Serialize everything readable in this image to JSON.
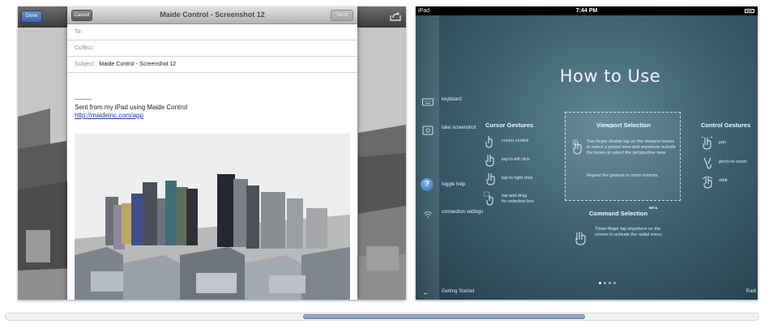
{
  "left_screenshot": {
    "toolbar": {
      "done_label": "Done"
    },
    "email": {
      "cancel_label": "Cancel",
      "title": "Maide Control - Screenshot 12",
      "send_label": "Send",
      "to_label": "To:",
      "ccbcc_label": "Cc/Bcc:",
      "subject_label": "Subject:",
      "subject_value": "Maide Control - Screenshot 12",
      "signature_dashes": "--------",
      "signature_text": "Sent from my iPad using Maide Control",
      "link": "http://maideinc.com/app"
    }
  },
  "right_screenshot": {
    "status_bar": {
      "carrier": "iPad",
      "time": "7:44 PM"
    },
    "sidebar": [
      {
        "label": "keyboard",
        "icon": "keyboard-icon"
      },
      {
        "label": "take screenshot",
        "icon": "screenshot-icon"
      },
      {
        "label": "toggle help",
        "icon": "help-icon"
      },
      {
        "label": "connection settings",
        "icon": "wifi-icon"
      }
    ],
    "title": "How to Use",
    "cursor_gestures": {
      "heading": "Cursor Gestures",
      "items": [
        "cursor control",
        "tap to left click",
        "tap to right click",
        "tap and drag",
        "for selection box"
      ]
    },
    "viewport_selection": {
      "heading": "Viewport Selection",
      "text1": "Two-finger double tap on the viewport boxes to select a preset view and anywhere outside the boxes to select the perspective view.",
      "text2": "Repeat the gesture to zoom extents."
    },
    "command_selection": {
      "heading": "Command Selection",
      "badge": "BETA",
      "text": "Three-finger tap anywhere on the screen to activate the radial menu."
    },
    "control_gestures": {
      "heading": "Control Gestures",
      "items": [
        "pan",
        "pinch-to-zoom",
        "orbit"
      ]
    },
    "page_dots": {
      "count": 4,
      "active": 1
    },
    "bottom_bar": {
      "left_label": "Getting Started",
      "right_label": "Radi"
    }
  },
  "scrollbar": {
    "position_fraction": 0.395,
    "visible_fraction": 0.375
  }
}
